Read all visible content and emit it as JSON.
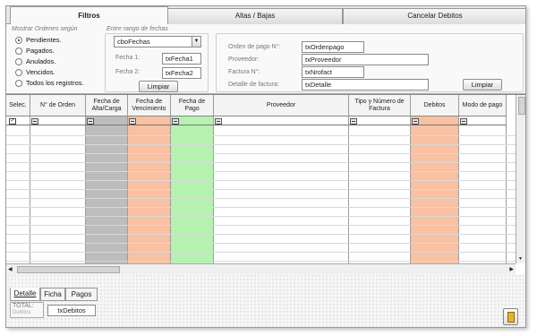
{
  "tabs": [
    "Filtros",
    "Altas / Bajas",
    "Cancelar Debitos"
  ],
  "filters": {
    "show_group_label": "Mostrar Ordenes según",
    "radios": [
      {
        "label": "Pendientes.",
        "selected": true
      },
      {
        "label": "Pagados.",
        "selected": false
      },
      {
        "label": "Anulados.",
        "selected": false
      },
      {
        "label": "Vencidos.",
        "selected": false
      },
      {
        "label": "Todos los registros.",
        "selected": false
      }
    ],
    "date_group_label": "Entre rango de fechas",
    "date_combo": "cboFechas",
    "fecha1_label": "Fecha 1:",
    "fecha1_value": "txFecha1",
    "fecha2_label": "Fecha 2:",
    "fecha2_value": "txFecha2",
    "clear_dates_label": "Limpiar",
    "order_label": "Orden de pago N°:",
    "order_value": "txOrdenpago",
    "provider_label": "Proveedor:",
    "provider_value": "txProveedor",
    "invoice_label": "Factura N°:",
    "invoice_value": "txNrofact",
    "detail_label": "Detalle de factura:",
    "detail_value": "txDetalle",
    "clear_label": "Limpiar"
  },
  "grid": {
    "columns": [
      {
        "label": "Selec.",
        "bg": "#ffffff"
      },
      {
        "label": "N° de Orden",
        "bg": "#ffffff"
      },
      {
        "label": "Fecha de Alta/Carga",
        "bg": "#bdbdbd"
      },
      {
        "label": "Fecha de Vencimiento",
        "bg": "#f9c0a2"
      },
      {
        "label": "Fecha de Pago",
        "bg": "#b6f2b0"
      },
      {
        "label": "Proveedor",
        "bg": "#ffffff"
      },
      {
        "label": "Tipo y Número de Factura",
        "bg": "#ffffff"
      },
      {
        "label": "Debitos",
        "bg": "#f9c0a2"
      },
      {
        "label": "Modo de pago",
        "bg": "#ffffff"
      }
    ],
    "filter_icon": "filter-icon",
    "select_all_checked": true
  },
  "bottom": {
    "tabs": [
      "Detalle",
      "Ficha",
      "Pagos"
    ],
    "total_label": "TOTAL:",
    "total_sub": "Debitos",
    "total_value": "txDebitos",
    "doc_icon": "document-icon"
  }
}
